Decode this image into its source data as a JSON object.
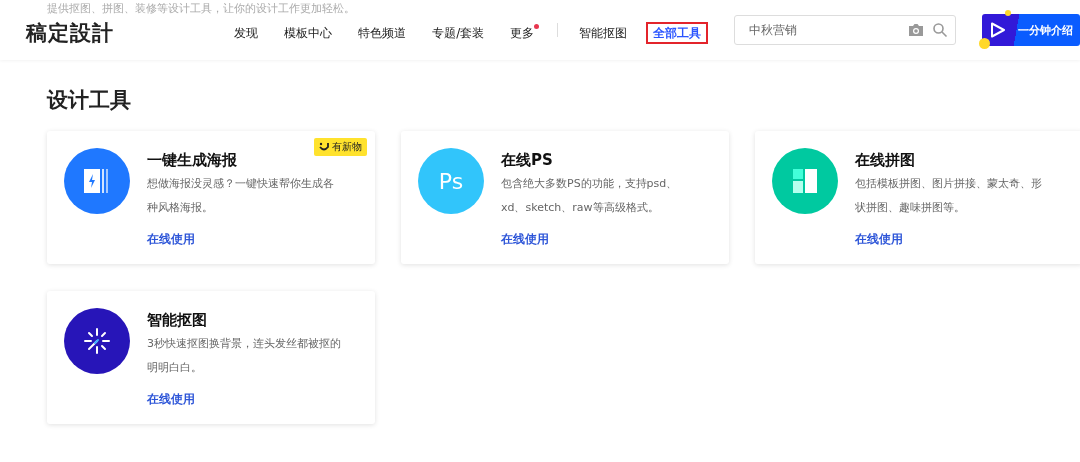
{
  "page_description": "提供抠图、拼图、装修等设计工具，让你的设计工作更加轻松。",
  "header": {
    "logo": "稿定設計",
    "nav": [
      {
        "label": "发现",
        "selected": false,
        "dot": false
      },
      {
        "label": "模板中心",
        "selected": false,
        "dot": false
      },
      {
        "label": "特色频道",
        "selected": false,
        "dot": false
      },
      {
        "label": "专题/套装",
        "selected": false,
        "dot": false
      },
      {
        "label": "更多",
        "selected": false,
        "dot": true
      },
      {
        "label": "智能抠图",
        "selected": false,
        "dot": false
      },
      {
        "label": "全部工具",
        "selected": true,
        "dot": false
      }
    ],
    "search": {
      "placeholder": "中秋营销"
    },
    "intro_button": "一分钟介绍"
  },
  "section_title": "设计工具",
  "tools": [
    {
      "kind": "poster",
      "title": "一键生成海报",
      "badge": "有新物",
      "description": "想做海报没灵感？一键快速帮你生成各种风格海报。",
      "link": "在线使用"
    },
    {
      "kind": "ps",
      "icon_text": "Ps",
      "title": "在线PS",
      "description": "包含绝大多数PS的功能，支持psd、xd、sketch、raw等高级格式。",
      "link": "在线使用"
    },
    {
      "kind": "collage",
      "title": "在线拼图",
      "description": "包括模板拼图、图片拼接、蒙太奇、形状拼图、趣味拼图等。",
      "link": "在线使用"
    },
    {
      "kind": "cutout",
      "title": "智能抠图",
      "description": "3秒快速抠图换背景，连头发丝都被抠的明明白白。",
      "link": "在线使用"
    }
  ]
}
